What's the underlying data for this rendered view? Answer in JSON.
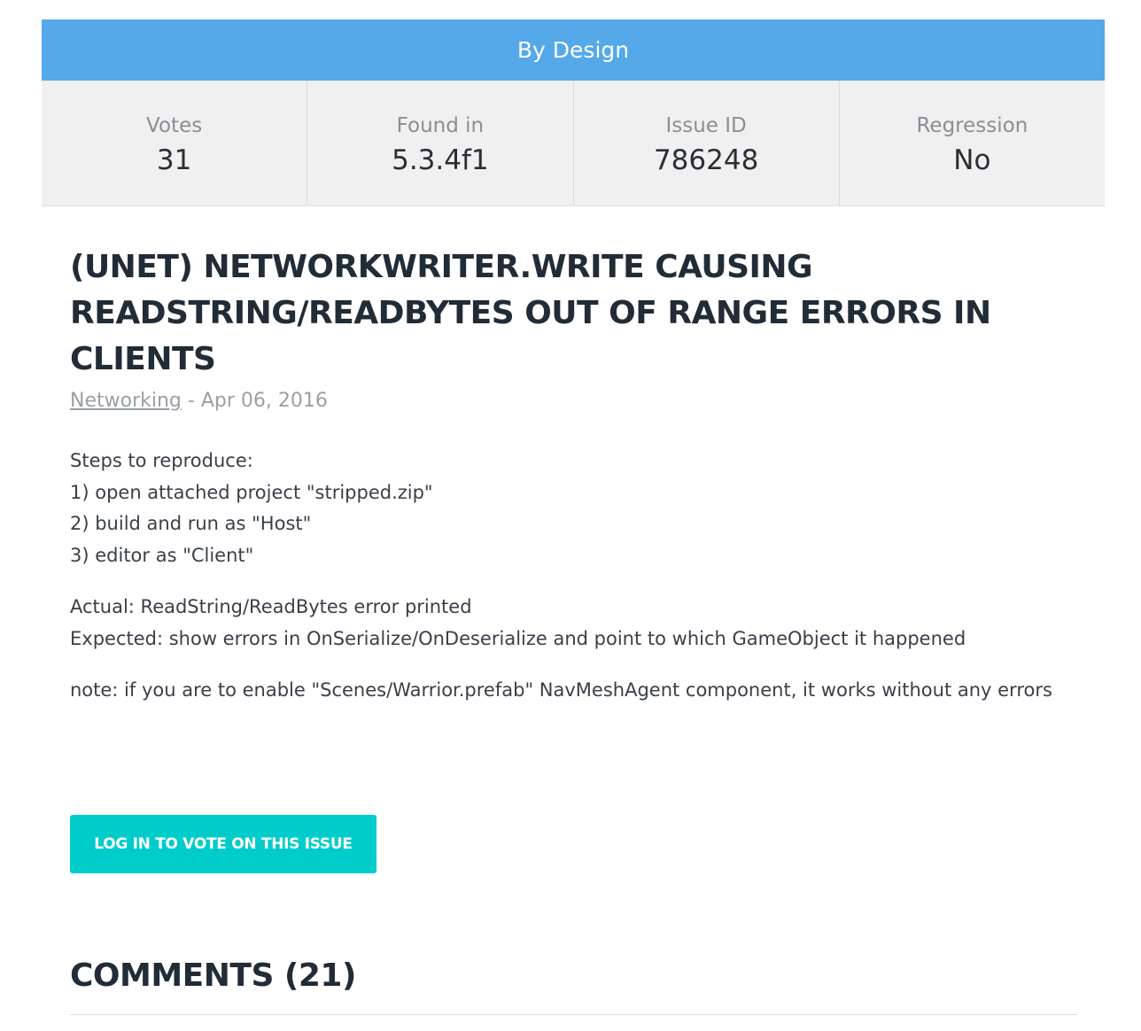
{
  "status": {
    "label": "By Design"
  },
  "stats": [
    {
      "label": "Votes",
      "value": "31"
    },
    {
      "label": "Found in",
      "value": "5.3.4f1"
    },
    {
      "label": "Issue ID",
      "value": "786248"
    },
    {
      "label": "Regression",
      "value": "No"
    }
  ],
  "issue": {
    "title_lines": [
      "(UNET) NETWORKWRITER.WRITE CAUSING",
      "READSTRING/READBYTES OUT OF RANGE ERRORS IN",
      "CLIENTS"
    ],
    "category": "Networking",
    "separator": " - ",
    "date": "Apr 06, 2016",
    "description": {
      "steps_title": "Steps to reproduce:",
      "steps": [
        "1) open attached project \"stripped.zip\"",
        "2) build and run as \"Host\"",
        "3) editor as \"Client\""
      ],
      "actual": "Actual: ReadString/ReadBytes error printed",
      "expected": "Expected: show errors in OnSerialize/OnDeserialize and point to which GameObject it happened",
      "note": "note: if you are to enable \"Scenes/Warrior.prefab\" NavMeshAgent component, it works without any errors"
    }
  },
  "vote_button": {
    "label": "LOG IN TO VOTE ON THIS ISSUE"
  },
  "comments": {
    "heading": "COMMENTS (21)"
  },
  "colors": {
    "status_bar": "#55a9e8",
    "stats_bg": "#f0f0f0",
    "vote_button": "#00cccc",
    "heading_text": "#222c37"
  }
}
